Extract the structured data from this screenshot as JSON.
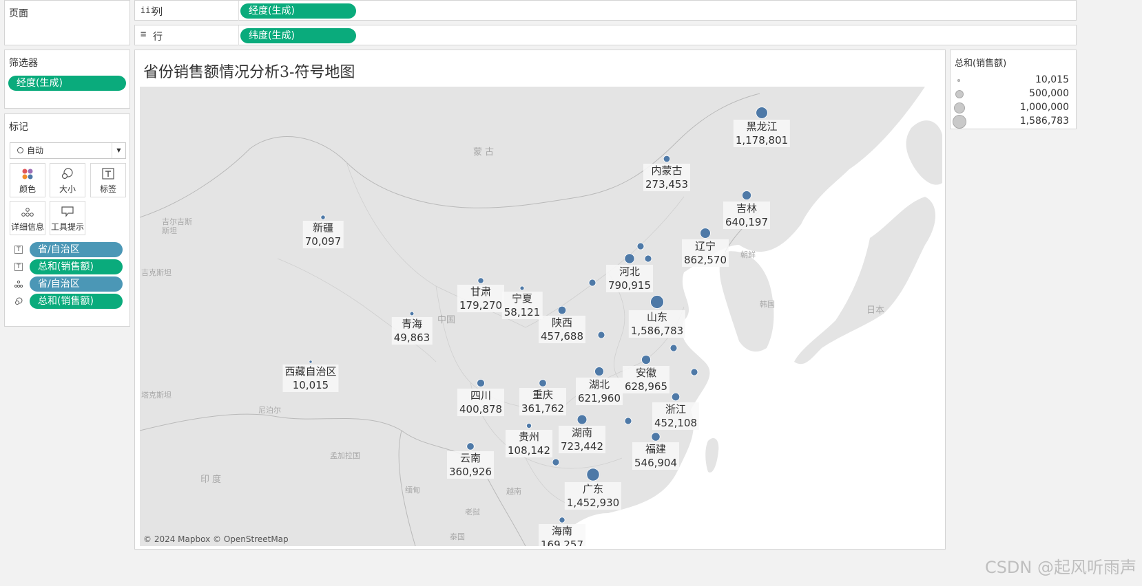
{
  "pages_panel": {
    "title": "页面"
  },
  "columns_shelf": {
    "icon": "iii",
    "label": "列",
    "pill": "经度(生成)"
  },
  "rows_shelf": {
    "icon": "≡",
    "label": "行",
    "pill": "纬度(生成)"
  },
  "filters": {
    "title": "筛选器",
    "items": [
      "经度(生成)"
    ]
  },
  "marks": {
    "title": "标记",
    "type_select": "自动",
    "buttons": [
      {
        "label": "颜色",
        "icon": "color-icon"
      },
      {
        "label": "大小",
        "icon": "size-icon"
      },
      {
        "label": "标签",
        "icon": "label-icon"
      },
      {
        "label": "详细信息",
        "icon": "detail-icon"
      },
      {
        "label": "工具提示",
        "icon": "tooltip-icon"
      }
    ],
    "fields": [
      {
        "icon": "label-icon",
        "text": "省/自治区",
        "color": "blue"
      },
      {
        "icon": "label-icon",
        "text": "总和(销售额)",
        "color": "green"
      },
      {
        "icon": "detail-icon",
        "text": "省/自治区",
        "color": "blue"
      },
      {
        "icon": "size-icon",
        "text": "总和(销售额)",
        "color": "green"
      }
    ]
  },
  "view": {
    "title": "省份销售额情况分析3-符号地图",
    "attribution": "© 2024 Mapbox © OpenStreetMap",
    "mark_color": "#4e79a7",
    "basemap_labels": [
      "蒙古",
      "中国",
      "日本",
      "朝鲜",
      "韩国",
      "印度",
      "尼泊尔",
      "孟加拉国",
      "缅甸",
      "老挝",
      "越南",
      "泰国",
      "吉尔吉斯斯坦",
      "吉克斯坦",
      "塔克斯坦"
    ]
  },
  "legend": {
    "title": "总和(销售额)",
    "items": [
      "10,015",
      "500,000",
      "1,000,000",
      "1,586,783"
    ]
  },
  "watermark": "CSDN @起风听雨声",
  "chart_data": {
    "type": "scatter",
    "title": "省份销售额情况分析3-符号地图",
    "xlabel": "经度(生成)",
    "ylabel": "纬度(生成)",
    "size_measure": "总和(销售额)",
    "points": [
      {
        "name": "黑龙江",
        "label": "1,178,801",
        "value": 1178801
      },
      {
        "name": "内蒙古",
        "label": "273,453",
        "value": 273453
      },
      {
        "name": "吉林",
        "label": "640,197",
        "value": 640197
      },
      {
        "name": "辽宁",
        "label": "862,570",
        "value": 862570
      },
      {
        "name": "新疆",
        "label": "70,097",
        "value": 70097
      },
      {
        "name": "河北",
        "label": "790,915",
        "value": 790915
      },
      {
        "name": "甘肃",
        "label": "179,270",
        "value": 179270
      },
      {
        "name": "宁夏",
        "label": "58,121",
        "value": 58121
      },
      {
        "name": "山东",
        "label": "1,586,783",
        "value": 1586783
      },
      {
        "name": "青海",
        "label": "49,863",
        "value": 49863
      },
      {
        "name": "陕西",
        "label": "457,688",
        "value": 457688
      },
      {
        "name": "安徽",
        "label": "628,965",
        "value": 628965
      },
      {
        "name": "西藏自治区",
        "label": "10,015",
        "value": 10015
      },
      {
        "name": "湖北",
        "label": "621,960",
        "value": 621960
      },
      {
        "name": "四川",
        "label": "400,878",
        "value": 400878
      },
      {
        "name": "重庆",
        "label": "361,762",
        "value": 361762
      },
      {
        "name": "浙江",
        "label": "452,108",
        "value": 452108
      },
      {
        "name": "湖南",
        "label": "723,442",
        "value": 723442
      },
      {
        "name": "贵州",
        "label": "108,142",
        "value": 108142
      },
      {
        "name": "福建",
        "label": "546,904",
        "value": 546904
      },
      {
        "name": "云南",
        "label": "360,926",
        "value": 360926
      },
      {
        "name": "广东",
        "label": "1,452,930",
        "value": 1452930
      },
      {
        "name": "海南",
        "label": "169,257",
        "value": 169257
      }
    ]
  }
}
